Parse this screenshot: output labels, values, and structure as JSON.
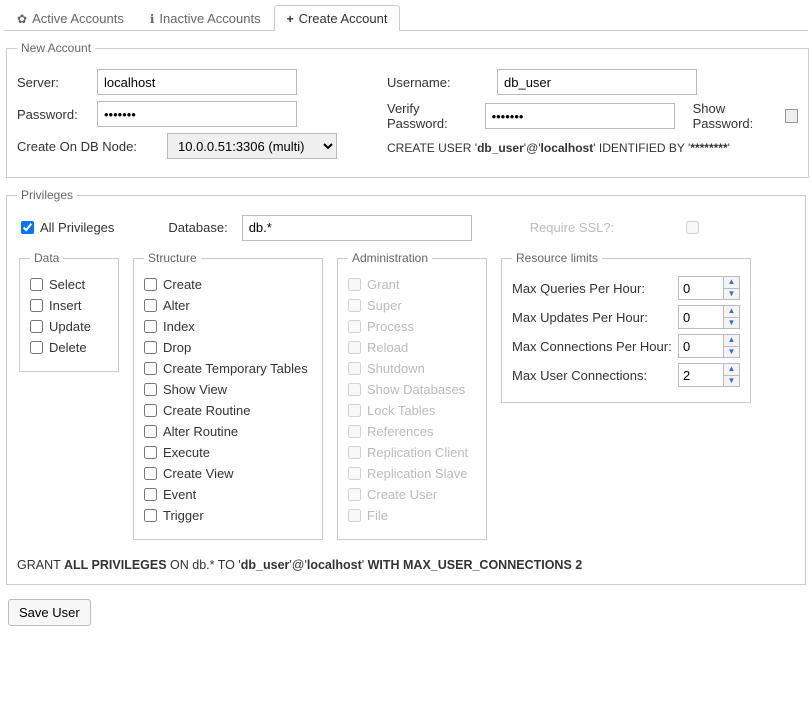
{
  "tabs": {
    "active": "Active Accounts",
    "inactive": "Inactive Accounts",
    "create": "Create Account"
  },
  "newAccount": {
    "legend": "New Account",
    "serverLabel": "Server:",
    "server": "localhost",
    "passwordLabel": "Password:",
    "password": "•••••••",
    "createOnLabel": "Create On DB Node:",
    "dbNode": "10.0.0.51:3306 (multi)",
    "usernameLabel": "Username:",
    "username": "db_user",
    "verifyLabel": "Verify Password:",
    "verifyPassword": "•••••••",
    "showPwLabel": "Show Password:",
    "stmtPrefix": "CREATE USER '",
    "stmtUser": "db_user",
    "stmtMid1": "'@'",
    "stmtHost": "localhost",
    "stmtMid2": "' IDENTIFIED BY '",
    "stmtMask": "********",
    "stmtEnd": "'"
  },
  "privileges": {
    "legend": "Privileges",
    "allPriv": "All Privileges",
    "dbLabel": "Database:",
    "database": "db.*",
    "requireSSL": "Require SSL?:",
    "groups": {
      "data": {
        "legend": "Data",
        "items": [
          "Select",
          "Insert",
          "Update",
          "Delete"
        ]
      },
      "structure": {
        "legend": "Structure",
        "items": [
          "Create",
          "Alter",
          "Index",
          "Drop",
          "Create Temporary Tables",
          "Show View",
          "Create Routine",
          "Alter Routine",
          "Execute",
          "Create View",
          "Event",
          "Trigger"
        ]
      },
      "admin": {
        "legend": "Administration",
        "items": [
          "Grant",
          "Super",
          "Process",
          "Reload",
          "Shutdown",
          "Show Databases",
          "Lock Tables",
          "References",
          "Replication Client",
          "Replication Slave",
          "Create User",
          "File"
        ]
      },
      "resource": {
        "legend": "Resource limits",
        "rows": [
          {
            "label": "Max Queries Per Hour:",
            "value": "0"
          },
          {
            "label": "Max Updates Per Hour:",
            "value": "0"
          },
          {
            "label": "Max Connections Per Hour:",
            "value": "0"
          },
          {
            "label": "Max User Connections:",
            "value": "2"
          }
        ]
      }
    },
    "grant": {
      "p1": "GRANT ",
      "b1": "ALL PRIVILEGES",
      "p2": " ON db.* TO '",
      "b2": "db_user",
      "p3": "'@'",
      "b3": "localhost",
      "p4": "' ",
      "b4": "WITH MAX_USER_CONNECTIONS 2"
    }
  },
  "saveLabel": "Save User"
}
